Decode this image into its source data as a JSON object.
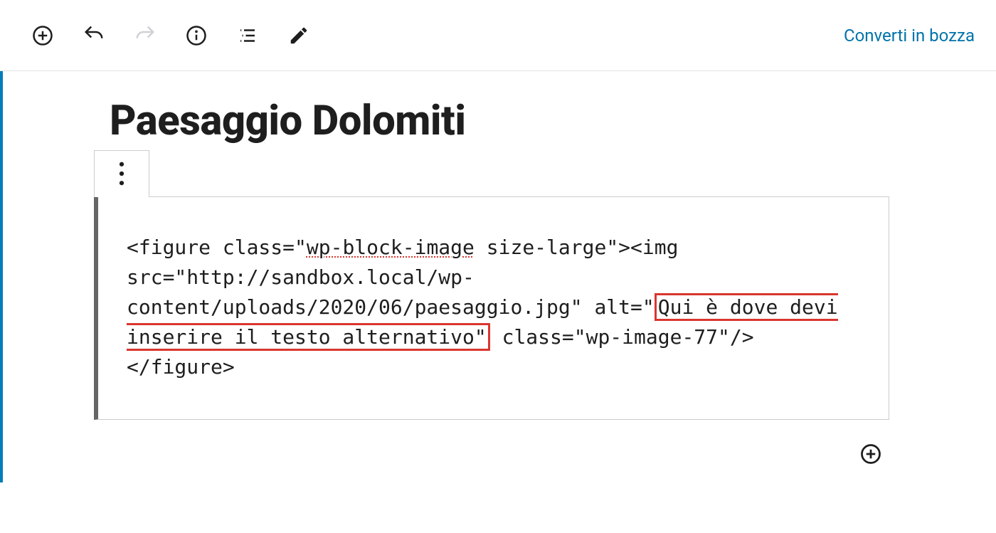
{
  "toolbar": {
    "convert_label": "Converti in bozza"
  },
  "post": {
    "title": "Paesaggio Dolomiti"
  },
  "code": {
    "seg1": "<figure class=\"",
    "spell": "wp-block-image",
    "seg2": " size-large\"><img src=\"http://sandbox.local/wp-content/uploads/2020/06/paesaggio.jpg\" alt=\"",
    "alt": "Qui è dove devi inserire il testo alternativo\"",
    "seg3": " class=\"wp-image-77\"/></figure>"
  }
}
